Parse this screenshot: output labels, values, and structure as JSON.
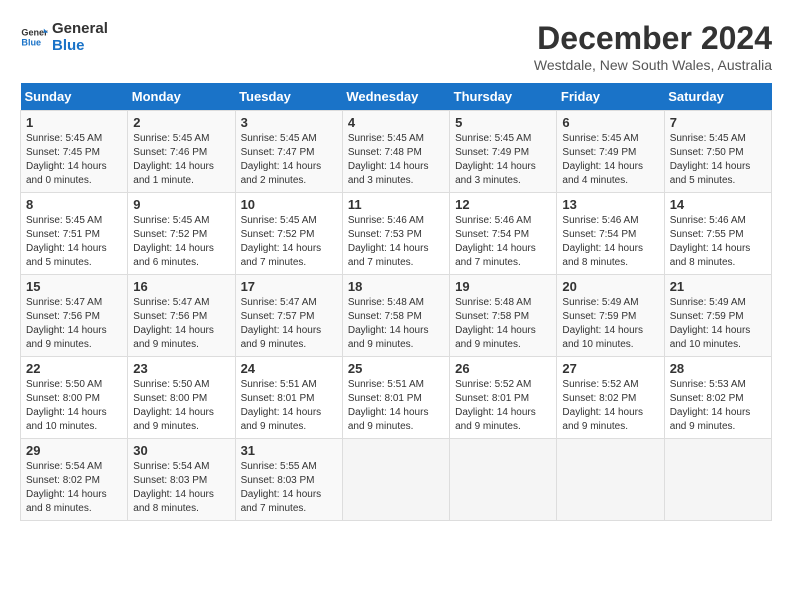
{
  "header": {
    "logo_line1": "General",
    "logo_line2": "Blue",
    "title": "December 2024",
    "location": "Westdale, New South Wales, Australia"
  },
  "calendar": {
    "weekdays": [
      "Sunday",
      "Monday",
      "Tuesday",
      "Wednesday",
      "Thursday",
      "Friday",
      "Saturday"
    ],
    "weeks": [
      [
        {
          "day": "",
          "info": ""
        },
        {
          "day": "2",
          "info": "Sunrise: 5:45 AM\nSunset: 7:46 PM\nDaylight: 14 hours\nand 1 minute."
        },
        {
          "day": "3",
          "info": "Sunrise: 5:45 AM\nSunset: 7:47 PM\nDaylight: 14 hours\nand 2 minutes."
        },
        {
          "day": "4",
          "info": "Sunrise: 5:45 AM\nSunset: 7:48 PM\nDaylight: 14 hours\nand 3 minutes."
        },
        {
          "day": "5",
          "info": "Sunrise: 5:45 AM\nSunset: 7:49 PM\nDaylight: 14 hours\nand 3 minutes."
        },
        {
          "day": "6",
          "info": "Sunrise: 5:45 AM\nSunset: 7:49 PM\nDaylight: 14 hours\nand 4 minutes."
        },
        {
          "day": "7",
          "info": "Sunrise: 5:45 AM\nSunset: 7:50 PM\nDaylight: 14 hours\nand 5 minutes."
        }
      ],
      [
        {
          "day": "1",
          "info": "Sunrise: 5:45 AM\nSunset: 7:45 PM\nDaylight: 14 hours\nand 0 minutes."
        },
        {
          "day": "",
          "info": ""
        },
        {
          "day": "",
          "info": ""
        },
        {
          "day": "",
          "info": ""
        },
        {
          "day": "",
          "info": ""
        },
        {
          "day": "",
          "info": ""
        },
        {
          "day": "",
          "info": ""
        }
      ],
      [
        {
          "day": "8",
          "info": "Sunrise: 5:45 AM\nSunset: 7:51 PM\nDaylight: 14 hours\nand 5 minutes."
        },
        {
          "day": "9",
          "info": "Sunrise: 5:45 AM\nSunset: 7:52 PM\nDaylight: 14 hours\nand 6 minutes."
        },
        {
          "day": "10",
          "info": "Sunrise: 5:45 AM\nSunset: 7:52 PM\nDaylight: 14 hours\nand 7 minutes."
        },
        {
          "day": "11",
          "info": "Sunrise: 5:46 AM\nSunset: 7:53 PM\nDaylight: 14 hours\nand 7 minutes."
        },
        {
          "day": "12",
          "info": "Sunrise: 5:46 AM\nSunset: 7:54 PM\nDaylight: 14 hours\nand 7 minutes."
        },
        {
          "day": "13",
          "info": "Sunrise: 5:46 AM\nSunset: 7:54 PM\nDaylight: 14 hours\nand 8 minutes."
        },
        {
          "day": "14",
          "info": "Sunrise: 5:46 AM\nSunset: 7:55 PM\nDaylight: 14 hours\nand 8 minutes."
        }
      ],
      [
        {
          "day": "15",
          "info": "Sunrise: 5:47 AM\nSunset: 7:56 PM\nDaylight: 14 hours\nand 9 minutes."
        },
        {
          "day": "16",
          "info": "Sunrise: 5:47 AM\nSunset: 7:56 PM\nDaylight: 14 hours\nand 9 minutes."
        },
        {
          "day": "17",
          "info": "Sunrise: 5:47 AM\nSunset: 7:57 PM\nDaylight: 14 hours\nand 9 minutes."
        },
        {
          "day": "18",
          "info": "Sunrise: 5:48 AM\nSunset: 7:58 PM\nDaylight: 14 hours\nand 9 minutes."
        },
        {
          "day": "19",
          "info": "Sunrise: 5:48 AM\nSunset: 7:58 PM\nDaylight: 14 hours\nand 9 minutes."
        },
        {
          "day": "20",
          "info": "Sunrise: 5:49 AM\nSunset: 7:59 PM\nDaylight: 14 hours\nand 10 minutes."
        },
        {
          "day": "21",
          "info": "Sunrise: 5:49 AM\nSunset: 7:59 PM\nDaylight: 14 hours\nand 10 minutes."
        }
      ],
      [
        {
          "day": "22",
          "info": "Sunrise: 5:50 AM\nSunset: 8:00 PM\nDaylight: 14 hours\nand 10 minutes."
        },
        {
          "day": "23",
          "info": "Sunrise: 5:50 AM\nSunset: 8:00 PM\nDaylight: 14 hours\nand 9 minutes."
        },
        {
          "day": "24",
          "info": "Sunrise: 5:51 AM\nSunset: 8:01 PM\nDaylight: 14 hours\nand 9 minutes."
        },
        {
          "day": "25",
          "info": "Sunrise: 5:51 AM\nSunset: 8:01 PM\nDaylight: 14 hours\nand 9 minutes."
        },
        {
          "day": "26",
          "info": "Sunrise: 5:52 AM\nSunset: 8:01 PM\nDaylight: 14 hours\nand 9 minutes."
        },
        {
          "day": "27",
          "info": "Sunrise: 5:52 AM\nSunset: 8:02 PM\nDaylight: 14 hours\nand 9 minutes."
        },
        {
          "day": "28",
          "info": "Sunrise: 5:53 AM\nSunset: 8:02 PM\nDaylight: 14 hours\nand 9 minutes."
        }
      ],
      [
        {
          "day": "29",
          "info": "Sunrise: 5:54 AM\nSunset: 8:02 PM\nDaylight: 14 hours\nand 8 minutes."
        },
        {
          "day": "30",
          "info": "Sunrise: 5:54 AM\nSunset: 8:03 PM\nDaylight: 14 hours\nand 8 minutes."
        },
        {
          "day": "31",
          "info": "Sunrise: 5:55 AM\nSunset: 8:03 PM\nDaylight: 14 hours\nand 7 minutes."
        },
        {
          "day": "",
          "info": ""
        },
        {
          "day": "",
          "info": ""
        },
        {
          "day": "",
          "info": ""
        },
        {
          "day": "",
          "info": ""
        }
      ]
    ]
  }
}
